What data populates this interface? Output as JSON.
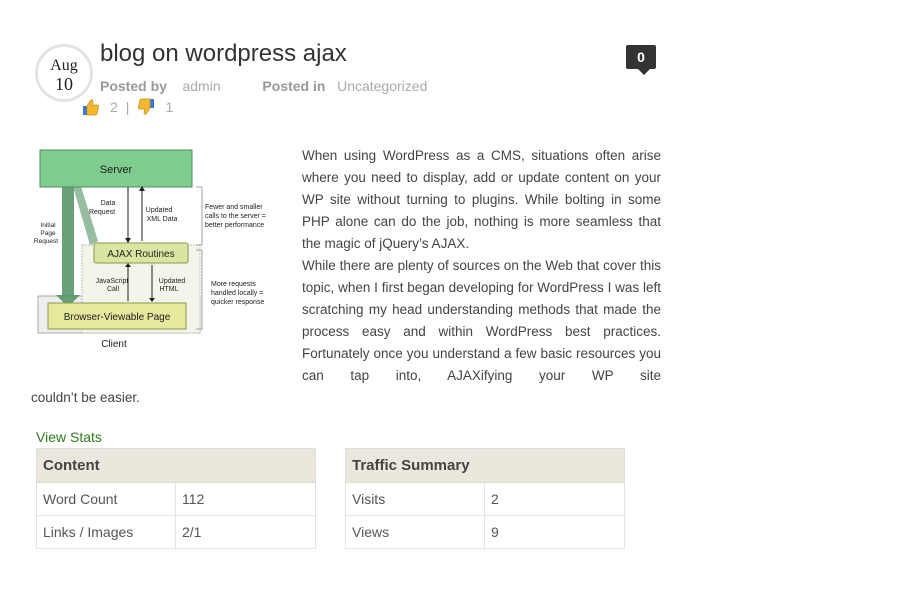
{
  "post": {
    "date": {
      "month": "Aug",
      "day": "10"
    },
    "title": "blog on wordpress ajax",
    "comments_count": "0",
    "meta": {
      "posted_by_label": "Posted by",
      "author": "admin",
      "posted_in_label": "Posted in",
      "category": "Uncategorized"
    },
    "votes": {
      "up": "2",
      "separator": "|",
      "down": "1"
    }
  },
  "diagram": {
    "server": "Server",
    "data_request": "Data\nRequest",
    "updated_xml": "Updated\nXML Data",
    "fewer_calls": "Fewer and smaller\ncalls to the server =\nbetter performance",
    "initial_request": "Initial\nPage\nRequest",
    "ajax_routines": "AJAX Routines",
    "js_call": "JavaScript\nCall",
    "updated_html": "Updated\nHTML",
    "more_requests": "More requests\nhandled locally =\nquicker response",
    "browser_page": "Browser-Viewable Page",
    "client": "Client"
  },
  "content": {
    "para1": "When using WordPress as a CMS, situations often arise where you need to display, add or update content on your WP site without turning to plugins. While bolting in some PHP alone can do the job, nothing is more seamless that the magic of jQuery’s AJAX.",
    "para2": "While there are plenty of sources on the Web that cover this topic, when I first began developing for WordPress I was left scratching my head understanding methods that made the process easy and within WordPress best practices. Fortunately once you understand a few basic resources you can tap into, AJAXifying your WP site",
    "para2_tail": "couldn’t be easier."
  },
  "stats": {
    "link": "View Stats",
    "content_table": {
      "header": "Content",
      "rows": [
        {
          "label": "Word Count",
          "value": "112"
        },
        {
          "label": "Links / Images",
          "value": "2/1"
        }
      ]
    },
    "traffic_table": {
      "header": "Traffic Summary",
      "rows": [
        {
          "label": "Visits",
          "value": "2"
        },
        {
          "label": "Views",
          "value": "9"
        }
      ]
    }
  },
  "colors": {
    "link_green": "#2e7d1a",
    "server_box": "#7fcc8f",
    "ajax_box": "#d9e6a1",
    "browser_box": "#e6e89c",
    "table_header": "#ebe7dd"
  }
}
